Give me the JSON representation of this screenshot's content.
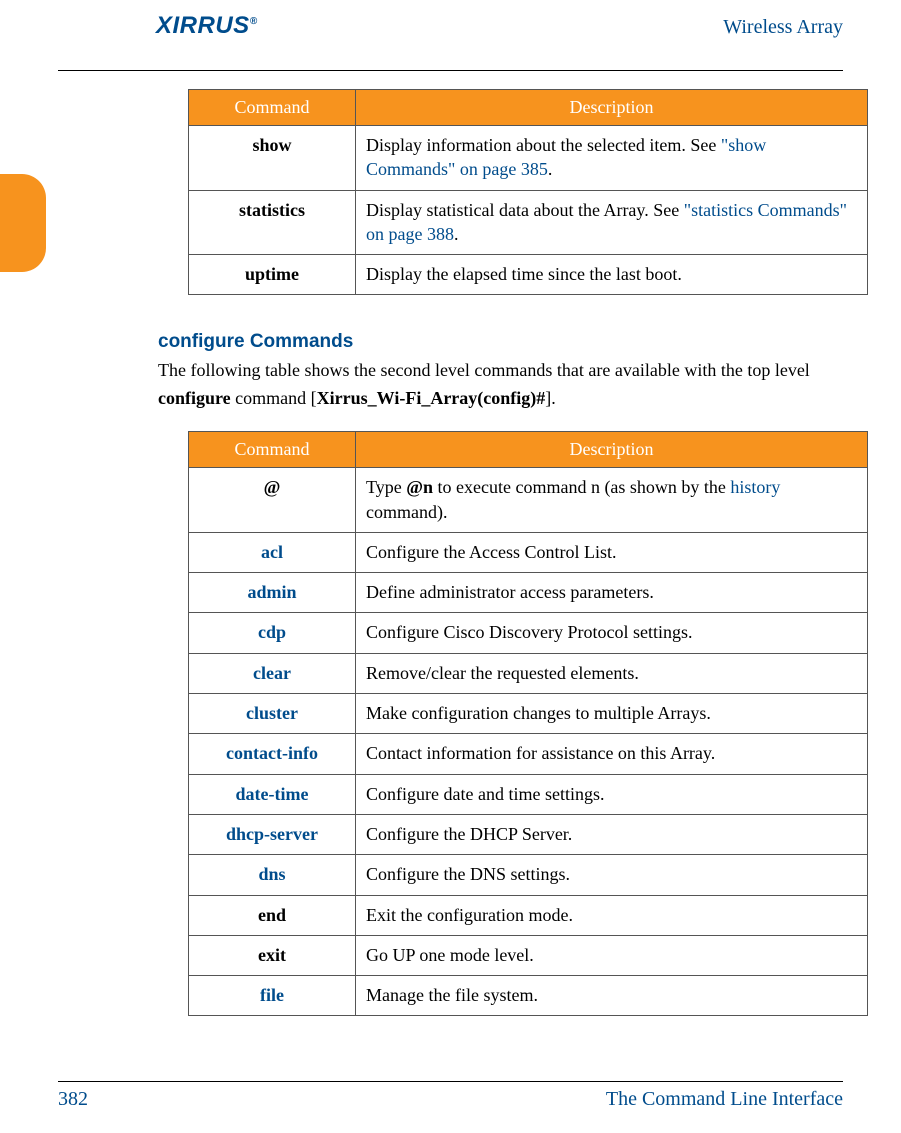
{
  "header": {
    "brand": "XIRRUS",
    "brand_sup": "®",
    "doc_title": "Wireless Array"
  },
  "side_tab": {
    "present": true
  },
  "table1": {
    "headers": {
      "cmd": "Command",
      "desc": "Description"
    },
    "rows": [
      {
        "cmd": "show",
        "cmd_class": "bold",
        "desc_pre": "Display information about the selected item. See ",
        "link": "\"show Commands\" on page 385",
        "desc_post": "."
      },
      {
        "cmd": "statistics",
        "cmd_class": "bold",
        "desc_pre": "Display statistical data about the Array. See ",
        "link": "\"statistics Commands\" on page 388",
        "desc_post": "."
      },
      {
        "cmd": "uptime",
        "cmd_class": "bold",
        "desc_pre": "Display the elapsed time since the last boot.",
        "link": "",
        "desc_post": ""
      }
    ]
  },
  "section": {
    "title": "configure Commands",
    "intro_pre": "The following table shows the second level commands that are available with the top level ",
    "intro_b1": "configure",
    "intro_mid": " command [",
    "intro_b2": "Xirrus_Wi-Fi_Array(config)#",
    "intro_post": "]."
  },
  "table2": {
    "headers": {
      "cmd": "Command",
      "desc": "Description"
    },
    "rows": [
      {
        "cmd": "@",
        "cmd_class": "bold",
        "desc_pre": "Type ",
        "bold1": "@n",
        "desc_mid": " to execute command n (as shown by the ",
        "link": "history",
        "desc_post": " command)."
      },
      {
        "cmd": "acl",
        "cmd_class": "link-blue",
        "desc": "Configure the Access Control List."
      },
      {
        "cmd": "admin",
        "cmd_class": "link-blue",
        "desc": "Define administrator access parameters."
      },
      {
        "cmd": "cdp",
        "cmd_class": "link-blue",
        "desc": " Configure Cisco Discovery Protocol settings."
      },
      {
        "cmd": "clear",
        "cmd_class": "link-blue",
        "desc": "Remove/clear the requested elements."
      },
      {
        "cmd": "cluster",
        "cmd_class": "link-blue",
        "desc": "Make configuration changes to multiple Arrays."
      },
      {
        "cmd": "contact-info",
        "cmd_class": "link-blue",
        "desc": "Contact information for assistance on this Array."
      },
      {
        "cmd": "date-time",
        "cmd_class": "link-blue",
        "desc": "Configure date and time settings."
      },
      {
        "cmd": "dhcp-server",
        "cmd_class": "link-blue",
        "desc": "Configure the DHCP Server."
      },
      {
        "cmd": "dns",
        "cmd_class": "link-blue",
        "desc": "Configure the DNS settings."
      },
      {
        "cmd": "end",
        "cmd_class": "bold",
        "desc": "Exit the configuration mode."
      },
      {
        "cmd": "exit",
        "cmd_class": "bold",
        "desc": "Go UP one mode level."
      },
      {
        "cmd": "file",
        "cmd_class": "link-blue",
        "desc": "Manage the file system."
      }
    ]
  },
  "footer": {
    "page": "382",
    "title": "The Command Line Interface"
  }
}
